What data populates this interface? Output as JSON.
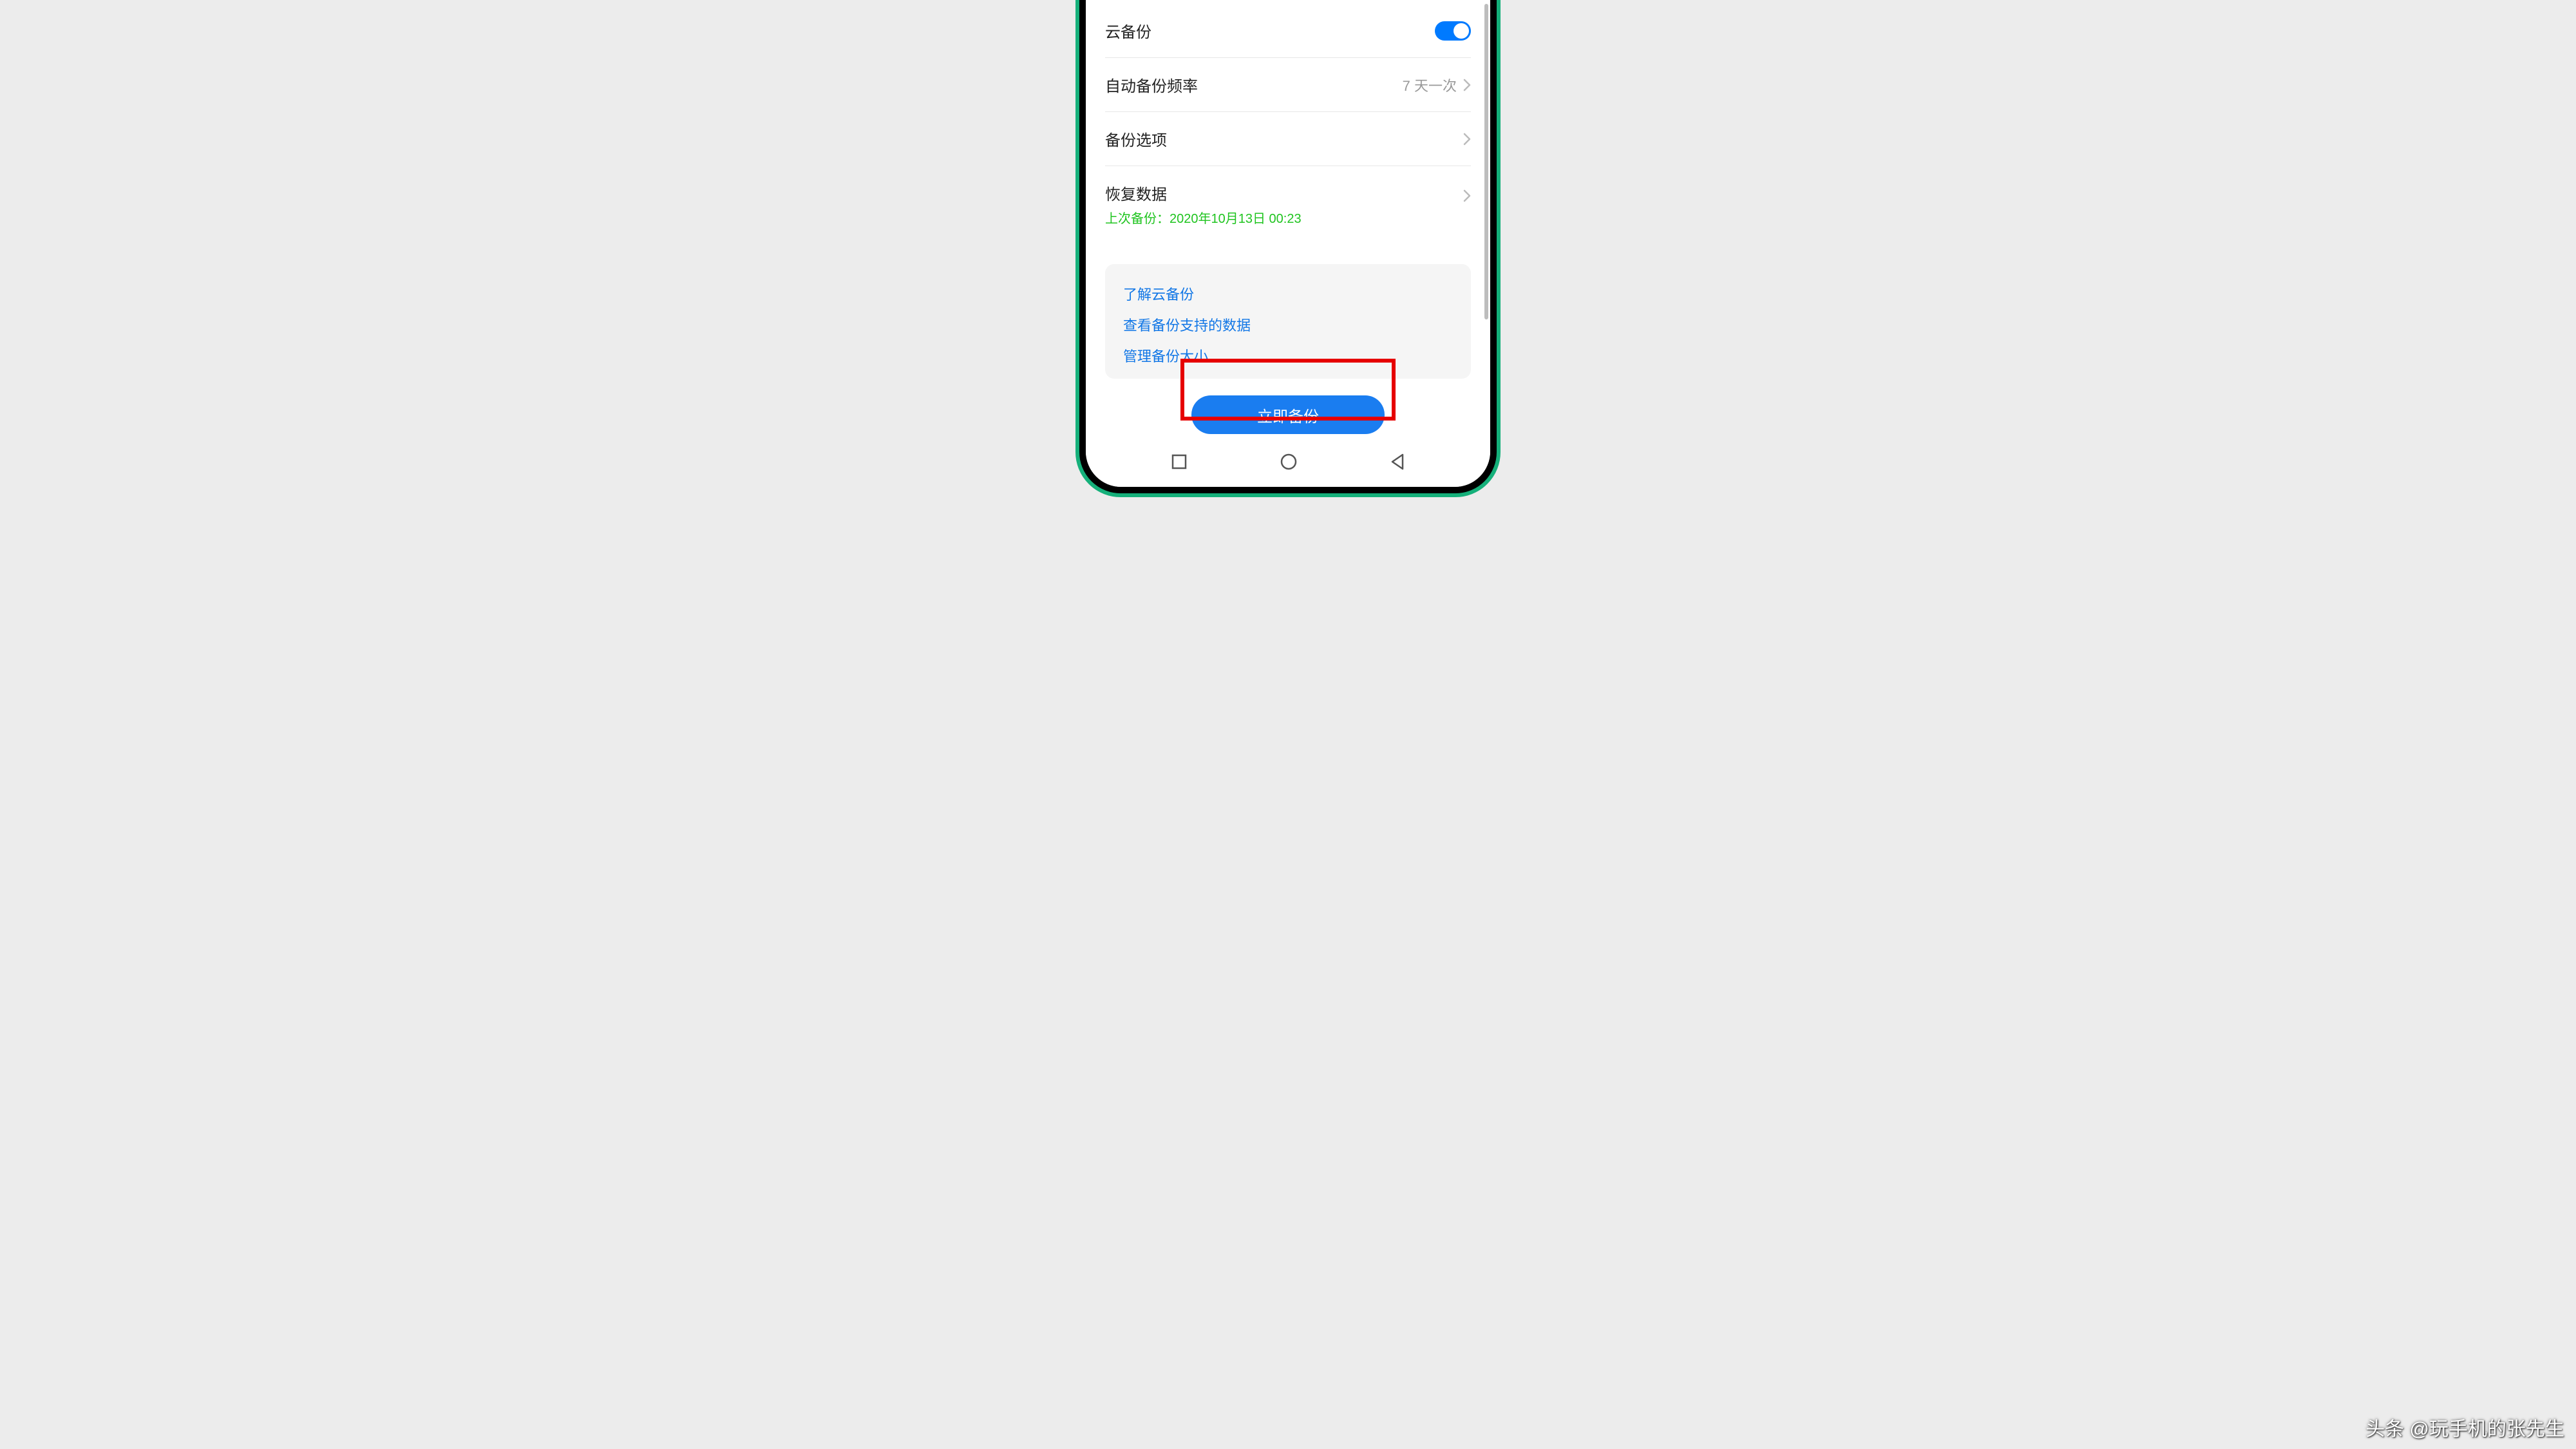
{
  "rows": {
    "cloud_backup": {
      "label": "云备份",
      "toggle_on": true
    },
    "frequency": {
      "label": "自动备份频率",
      "value": "7 天一次"
    },
    "options": {
      "label": "备份选项"
    },
    "restore": {
      "label": "恢复数据",
      "last_backup": "上次备份：2020年10月13日 00:23"
    }
  },
  "links": {
    "learn": "了解云备份",
    "supported": "查看备份支持的数据",
    "manage": "管理备份大小"
  },
  "primary_button": "立即备份",
  "watermark": "头条 @玩手机的张先生"
}
